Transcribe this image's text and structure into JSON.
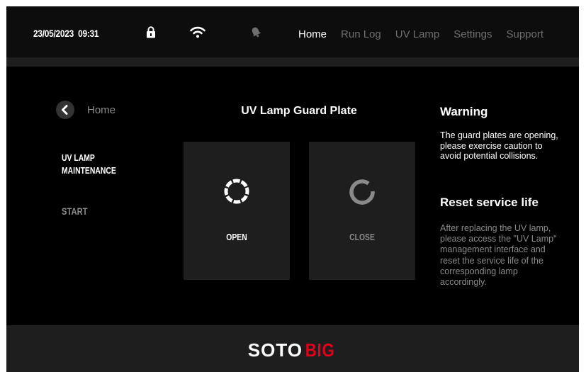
{
  "status": {
    "date": "23/05/2023",
    "time": "09:31"
  },
  "icons": [
    "lock-icon",
    "wifi-icon",
    "bell-icon",
    "chevron-left-icon",
    "loading-dashed-ring-icon",
    "refresh-ring-icon"
  ],
  "nav": {
    "items": [
      {
        "label": "Home"
      },
      {
        "label": "Run Log"
      },
      {
        "label": "UV Lamp"
      },
      {
        "label": "Settings"
      },
      {
        "label": "Support"
      }
    ],
    "active": "Home"
  },
  "sidebar": {
    "back_label": "Home",
    "section_title": "UV LAMP MAINTENANCE",
    "step_label": "START"
  },
  "panel": {
    "title": "UV Lamp Guard Plate",
    "open_label": "OPEN",
    "close_label": "CLOSE"
  },
  "info": {
    "warning_title": "Warning",
    "warning_text": "The guard plates are opening, please exercise caution to avoid potential collisions.",
    "reset_title": "Reset service life",
    "reset_text": "After replacing the UV lamp, please access the \"UV Lamp\" management interface and reset the service life of the corresponding lamp accordingly."
  },
  "footer": {
    "logo_part1": "SOTO",
    "logo_part2": "BIG"
  },
  "colors": {
    "background": "#000000",
    "panel": "#1e1e1e",
    "text": "#ffffff",
    "muted": "#8a8a8a",
    "brand_red": "#e3001b"
  }
}
